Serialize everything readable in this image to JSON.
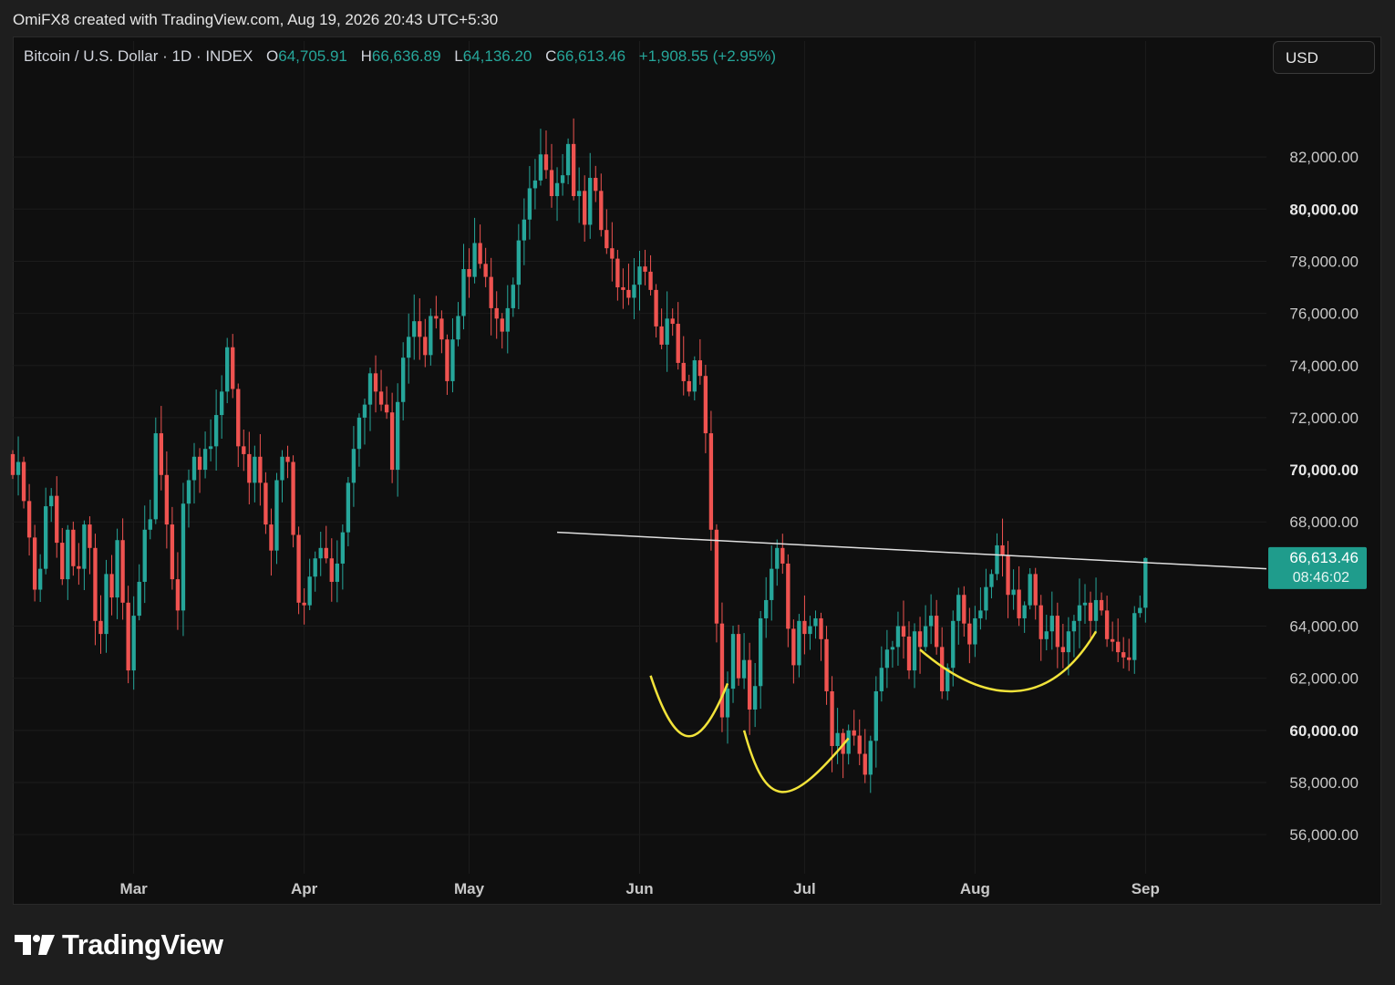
{
  "header": {
    "attribution": "OmiFX8 created with TradingView.com, Aug 19, 2026 20:43 UTC+5:30"
  },
  "legend": {
    "symbol": "Bitcoin / U.S. Dollar · 1D · INDEX",
    "open_label": "O",
    "open": "64,705.91",
    "high_label": "H",
    "high": "66,636.89",
    "low_label": "L",
    "low": "64,136.20",
    "close_label": "C",
    "close": "66,613.46",
    "change": "+1,908.55 (+2.95%)"
  },
  "currency_button": "USD",
  "price_tag": {
    "price": "66,613.46",
    "countdown": "08:46:02"
  },
  "brand": {
    "name": "TradingView"
  },
  "colors": {
    "up": "#26a69a",
    "down": "#ef5350",
    "background": "#0f0f0f",
    "grid": "#1c1c1c",
    "trendline": "#e0e0e0",
    "pattern": "#f2e33a",
    "tag": "#1f9c8c"
  },
  "chart_data": {
    "type": "candlestick",
    "y_ticks": [
      {
        "value": 82000,
        "label": "82,000.00",
        "bold": false
      },
      {
        "value": 80000,
        "label": "80,000.00",
        "bold": true
      },
      {
        "value": 78000,
        "label": "78,000.00",
        "bold": false
      },
      {
        "value": 76000,
        "label": "76,000.00",
        "bold": false
      },
      {
        "value": 74000,
        "label": "74,000.00",
        "bold": false
      },
      {
        "value": 72000,
        "label": "72,000.00",
        "bold": false
      },
      {
        "value": 70000,
        "label": "70,000.00",
        "bold": true
      },
      {
        "value": 68000,
        "label": "68,000.00",
        "bold": false
      },
      {
        "value": 64000,
        "label": "64,000.00",
        "bold": false
      },
      {
        "value": 62000,
        "label": "62,000.00",
        "bold": false
      },
      {
        "value": 60000,
        "label": "60,000.00",
        "bold": true
      },
      {
        "value": 58000,
        "label": "58,000.00",
        "bold": false
      },
      {
        "value": 56000,
        "label": "56,000.00",
        "bold": false
      }
    ],
    "x_ticks": [
      {
        "date": "2026-03-01",
        "label": "Mar"
      },
      {
        "date": "2026-04-01",
        "label": "Apr"
      },
      {
        "date": "2026-05-01",
        "label": "May"
      },
      {
        "date": "2026-06-01",
        "label": "Jun"
      },
      {
        "date": "2026-07-01",
        "label": "Jul"
      },
      {
        "date": "2026-08-01",
        "label": "Aug"
      },
      {
        "date": "2026-09-01",
        "label": "Sep"
      }
    ],
    "x_range": [
      "2026-02-07",
      "2026-09-23"
    ],
    "y_range": [
      54500,
      84700
    ],
    "trendline": {
      "start": [
        "2026-05-17",
        67600
      ],
      "end": [
        "2026-09-23",
        66200
      ]
    },
    "pattern_curves": [
      [
        [
          "2026-06-03",
          62100
        ],
        [
          "2026-06-08",
          58900
        ],
        [
          "2026-06-12",
          59200
        ],
        [
          "2026-06-17",
          61800
        ]
      ],
      [
        [
          "2026-06-20",
          60000
        ],
        [
          "2026-06-24",
          56900
        ],
        [
          "2026-06-28",
          56900
        ],
        [
          "2026-07-09",
          59700
        ]
      ],
      [
        [
          "2026-07-22",
          63100
        ],
        [
          "2026-08-02",
          61100
        ],
        [
          "2026-08-14",
          60600
        ],
        [
          "2026-08-23",
          63800
        ]
      ]
    ],
    "candles": [
      [
        70600,
        69800
      ],
      [
        69800,
        70300
      ],
      [
        70300,
        68800
      ],
      [
        68800,
        67400
      ],
      [
        67400,
        65400
      ],
      [
        65400,
        66200
      ],
      [
        66200,
        68600
      ],
      [
        68600,
        69000
      ],
      [
        69000,
        67200
      ],
      [
        67200,
        65800
      ],
      [
        65800,
        67700
      ],
      [
        67700,
        66300
      ],
      [
        66300,
        66200
      ],
      [
        66200,
        67900
      ],
      [
        67900,
        67000
      ],
      [
        67000,
        64200
      ],
      [
        64200,
        63700
      ],
      [
        63700,
        66000
      ],
      [
        66000,
        65100
      ],
      [
        65100,
        67300
      ],
      [
        67300,
        64900
      ],
      [
        64900,
        62300
      ],
      [
        62300,
        64400
      ],
      [
        64400,
        65700
      ],
      [
        65700,
        67700
      ],
      [
        67700,
        68100
      ],
      [
        68100,
        71400
      ],
      [
        71400,
        69800
      ],
      [
        69800,
        67900
      ],
      [
        67900,
        65800
      ],
      [
        65800,
        64600
      ],
      [
        64600,
        68700
      ],
      [
        68700,
        69600
      ],
      [
        69600,
        70500
      ],
      [
        70500,
        70000
      ],
      [
        70000,
        70800
      ],
      [
        70800,
        70900
      ],
      [
        70900,
        72100
      ],
      [
        72100,
        73000
      ],
      [
        73000,
        74700
      ],
      [
        74700,
        73100
      ],
      [
        73100,
        70900
      ],
      [
        70900,
        70600
      ],
      [
        70600,
        69500
      ],
      [
        69500,
        70500
      ],
      [
        70500,
        69500
      ],
      [
        69500,
        67900
      ],
      [
        67900,
        66900
      ],
      [
        66900,
        69600
      ],
      [
        69600,
        70500
      ],
      [
        70500,
        70300
      ],
      [
        70300,
        67500
      ],
      [
        67500,
        64900
      ],
      [
        64900,
        64800
      ],
      [
        64800,
        65900
      ],
      [
        65900,
        66600
      ],
      [
        66600,
        67000
      ],
      [
        67000,
        66600
      ],
      [
        66600,
        65700
      ],
      [
        65700,
        66400
      ],
      [
        66400,
        67600
      ],
      [
        67600,
        69500
      ],
      [
        69500,
        70800
      ],
      [
        70800,
        72000
      ],
      [
        72000,
        72500
      ],
      [
        72500,
        73700
      ],
      [
        73700,
        73000
      ],
      [
        73000,
        72500
      ],
      [
        72500,
        72200
      ],
      [
        72200,
        70000
      ],
      [
        70000,
        72600
      ],
      [
        72600,
        74300
      ],
      [
        74300,
        75100
      ],
      [
        75100,
        75700
      ],
      [
        75700,
        75100
      ],
      [
        75100,
        74400
      ],
      [
        74400,
        75900
      ],
      [
        75900,
        75800
      ],
      [
        75800,
        75000
      ],
      [
        75000,
        73400
      ],
      [
        73400,
        75000
      ],
      [
        75000,
        75900
      ],
      [
        75900,
        77700
      ],
      [
        77700,
        77400
      ],
      [
        77400,
        78700
      ],
      [
        78700,
        77900
      ],
      [
        77900,
        77400
      ],
      [
        77400,
        76200
      ],
      [
        76200,
        75800
      ],
      [
        75800,
        75300
      ],
      [
        75300,
        76200
      ],
      [
        76200,
        77100
      ],
      [
        77100,
        78800
      ],
      [
        78800,
        79600
      ],
      [
        79600,
        80800
      ],
      [
        80800,
        81100
      ],
      [
        81100,
        82100
      ],
      [
        82100,
        81500
      ],
      [
        81500,
        80500
      ],
      [
        80500,
        81000
      ],
      [
        81000,
        81300
      ],
      [
        81300,
        82500
      ],
      [
        82500,
        80500
      ],
      [
        80500,
        80700
      ],
      [
        80700,
        79400
      ],
      [
        79400,
        81200
      ],
      [
        81200,
        80700
      ],
      [
        80700,
        79200
      ],
      [
        79200,
        78500
      ],
      [
        78500,
        78100
      ],
      [
        78100,
        77000
      ],
      [
        77000,
        76900
      ],
      [
        76900,
        76600
      ],
      [
        76600,
        77100
      ],
      [
        77100,
        77800
      ],
      [
        77800,
        77600
      ],
      [
        77600,
        76900
      ],
      [
        76900,
        75500
      ],
      [
        75500,
        74800
      ],
      [
        74800,
        75800
      ],
      [
        75800,
        75600
      ],
      [
        75600,
        74100
      ],
      [
        74100,
        73400
      ],
      [
        73400,
        73000
      ],
      [
        73000,
        74200
      ],
      [
        74200,
        73600
      ],
      [
        73600,
        71400
      ],
      [
        71400,
        67700
      ],
      [
        67700,
        64100
      ],
      [
        64100,
        60500
      ],
      [
        60500,
        61600
      ],
      [
        61600,
        63700
      ],
      [
        63700,
        62000
      ],
      [
        62000,
        62700
      ],
      [
        62700,
        60800
      ],
      [
        60800,
        61700
      ],
      [
        61700,
        64300
      ],
      [
        64300,
        65000
      ],
      [
        65000,
        66200
      ],
      [
        66200,
        67000
      ],
      [
        67000,
        66400
      ],
      [
        66400,
        63900
      ],
      [
        63900,
        62500
      ],
      [
        62500,
        64200
      ],
      [
        64200,
        63700
      ],
      [
        63700,
        64000
      ],
      [
        64000,
        64300
      ],
      [
        64300,
        63500
      ],
      [
        63500,
        61500
      ],
      [
        61500,
        59400
      ],
      [
        59400,
        59900
      ],
      [
        59900,
        59100
      ],
      [
        59100,
        60000
      ],
      [
        60000,
        59800
      ],
      [
        59800,
        59100
      ],
      [
        59100,
        58300
      ],
      [
        58300,
        59600
      ],
      [
        59600,
        61500
      ],
      [
        61500,
        62400
      ],
      [
        62400,
        63100
      ],
      [
        63100,
        63200
      ],
      [
        63200,
        64000
      ],
      [
        64000,
        63600
      ],
      [
        63600,
        62300
      ],
      [
        62300,
        63800
      ],
      [
        63800,
        63200
      ],
      [
        63200,
        64000
      ],
      [
        64000,
        64400
      ],
      [
        64400,
        63200
      ],
      [
        63200,
        61500
      ],
      [
        61500,
        62400
      ],
      [
        62400,
        64200
      ],
      [
        64200,
        65200
      ],
      [
        65200,
        64100
      ],
      [
        64100,
        63300
      ],
      [
        63300,
        64300
      ],
      [
        64300,
        64600
      ],
      [
        64600,
        65500
      ],
      [
        65500,
        66000
      ],
      [
        66000,
        67100
      ],
      [
        67100,
        66700
      ],
      [
        66700,
        65200
      ],
      [
        65200,
        65400
      ],
      [
        65400,
        64300
      ],
      [
        64300,
        64800
      ],
      [
        64800,
        66000
      ],
      [
        66000,
        64800
      ],
      [
        64800,
        63500
      ],
      [
        63500,
        63800
      ],
      [
        63800,
        64400
      ],
      [
        64400,
        63200
      ],
      [
        63200,
        63000
      ],
      [
        63000,
        63800
      ],
      [
        63800,
        64200
      ],
      [
        64200,
        64800
      ],
      [
        64800,
        64900
      ],
      [
        64900,
        64200
      ],
      [
        64200,
        65000
      ],
      [
        65000,
        64600
      ],
      [
        64600,
        63500
      ],
      [
        63500,
        63400
      ],
      [
        63400,
        63000
      ],
      [
        63000,
        62800
      ],
      [
        62800,
        62700
      ],
      [
        62700,
        64500
      ],
      [
        64500,
        64700
      ],
      [
        64705.91,
        66613.46
      ]
    ],
    "last_price": 66613.46
  }
}
